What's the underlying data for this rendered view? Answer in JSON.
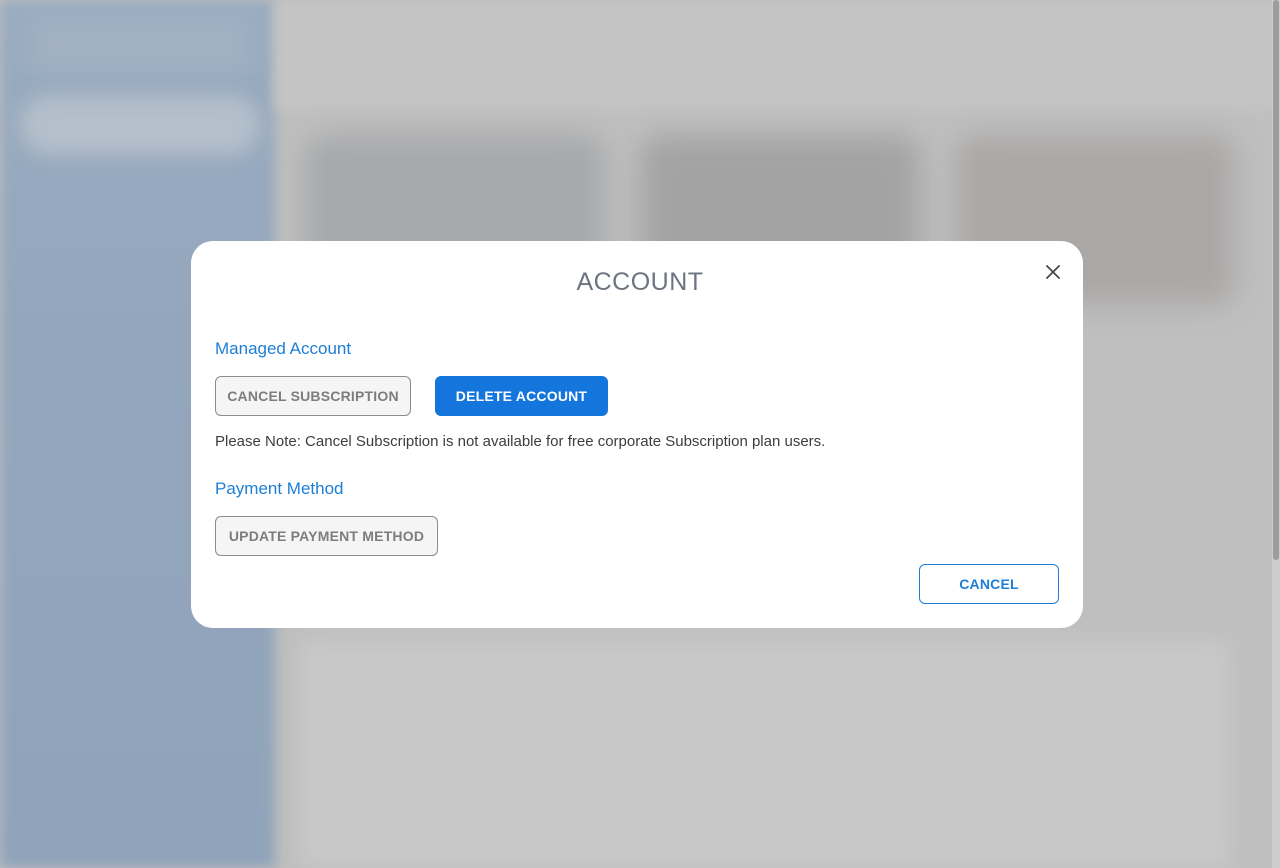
{
  "modal": {
    "title": "ACCOUNT",
    "close_icon": "close-icon",
    "managed_account": {
      "heading": "Managed Account",
      "cancel_subscription_label": "CANCEL SUBSCRIPTION",
      "delete_account_label": "DELETE ACCOUNT",
      "note": "Please Note: Cancel Subscription is not available for free corporate Subscription plan users."
    },
    "payment_method": {
      "heading": "Payment Method",
      "update_label": "UPDATE PAYMENT METHOD"
    },
    "cancel_label": "CANCEL"
  },
  "colors": {
    "accent": "#1E7ED6",
    "primary_button": "#1475DD",
    "title_text": "#6B7480",
    "overlay_backdrop": "#BFBFBF"
  }
}
